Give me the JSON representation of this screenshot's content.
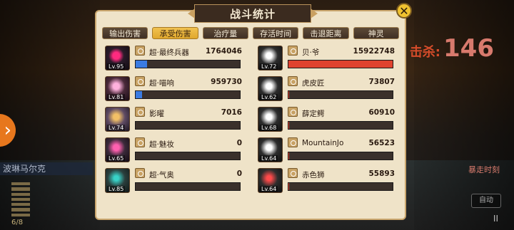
{
  "header": {
    "title": "战斗统计"
  },
  "tabs": [
    {
      "label": "输出伤害",
      "active": false
    },
    {
      "label": "承受伤害",
      "active": true
    },
    {
      "label": "治疗量",
      "active": false
    },
    {
      "label": "存活时间",
      "active": false
    },
    {
      "label": "击退距离",
      "active": false
    },
    {
      "label": "神灵",
      "active": false
    }
  ],
  "left_units": [
    {
      "name": "超·最终兵器",
      "value": "1764046",
      "level": "Lv.95",
      "bar_fraction": 0.11,
      "bar_color": "#3a7be2"
    },
    {
      "name": "超·喵响",
      "value": "959730",
      "level": "Lv.81",
      "bar_fraction": 0.06,
      "bar_color": "#3a7be2"
    },
    {
      "name": "影曜",
      "value": "7016",
      "level": "Lv.74",
      "bar_fraction": 0.0,
      "bar_color": "#3a7be2"
    },
    {
      "name": "超·魅妆",
      "value": "0",
      "level": "Lv.65",
      "bar_fraction": 0.0,
      "bar_color": "#3a7be2"
    },
    {
      "name": "超·气奥",
      "value": "0",
      "level": "Lv.85",
      "bar_fraction": 0.0,
      "bar_color": "#3a7be2"
    }
  ],
  "right_units": [
    {
      "name": "贝·爷",
      "value": "15922748",
      "level": "Lv.72",
      "bar_fraction": 1.0,
      "bar_color": "#e0432f"
    },
    {
      "name": "虎皮匠",
      "value": "73807",
      "level": "Lv.62",
      "bar_fraction": 0.005,
      "bar_color": "#e0432f"
    },
    {
      "name": "薛定鳄",
      "value": "60910",
      "level": "Lv.68",
      "bar_fraction": 0.004,
      "bar_color": "#e0432f"
    },
    {
      "name": "MountainJo",
      "value": "56523",
      "level": "Lv.64",
      "bar_fraction": 0.0035,
      "bar_color": "#e0432f"
    },
    {
      "name": "赤色狮",
      "value": "55893",
      "level": "Lv.64",
      "bar_fraction": 0.0035,
      "bar_color": "#e0432f"
    }
  ],
  "background": {
    "left_label": "波琳马尔克",
    "kills_label": "击杀:",
    "kills_value": "146",
    "right_label": "暴走时刻",
    "auto_label": "自动",
    "pause_icon": "II",
    "count": "6/8"
  }
}
